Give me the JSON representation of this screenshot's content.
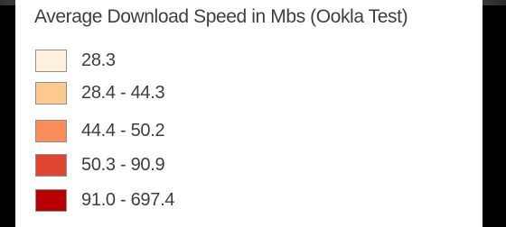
{
  "legend": {
    "title": "Average Download Speed in Mbs (Ookla Test)",
    "items": [
      {
        "label": "28.3",
        "color": "#fff0de"
      },
      {
        "label": "28.4 - 44.3",
        "color": "#fdc98e"
      },
      {
        "label": "44.4 - 50.2",
        "color": "#fb8d5b"
      },
      {
        "label": "50.3 - 90.9",
        "color": "#e04531"
      },
      {
        "label": "91.0 - 697.4",
        "color": "#b70000"
      }
    ]
  }
}
